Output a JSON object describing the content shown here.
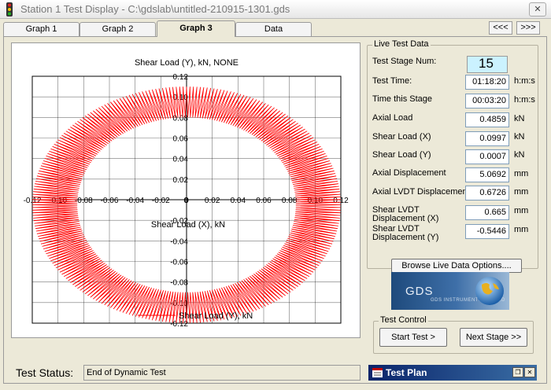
{
  "window": {
    "title": "Station 1 Test Display - C:\\gdslab\\untitled-210915-1301.gds",
    "close_label": "✕"
  },
  "tabs": [
    {
      "label": "Graph 1"
    },
    {
      "label": "Graph 2"
    },
    {
      "label": "Graph 3"
    },
    {
      "label": "Data"
    }
  ],
  "nav": {
    "prev_label": "<<<",
    "next_label": ">>>"
  },
  "chart_data": {
    "type": "line",
    "title": "Shear Load (Y), kN, NONE",
    "xlabel": "Shear Load (X), kN",
    "ylabel": "",
    "xlim": [
      -0.12,
      0.12
    ],
    "ylim": [
      -0.12,
      0.12
    ],
    "x_ticks": [
      "-0.12",
      "-0.10",
      "-0.08",
      "-0.06",
      "-0.04",
      "-0.02",
      "0",
      "0.02",
      "0.04",
      "0.06",
      "0.08",
      "0.10",
      "0.12"
    ],
    "y_ticks": [
      "0.12",
      "0.10",
      "0.08",
      "0.06",
      "0.04",
      "0.02",
      "0",
      "-0.02",
      "-0.04",
      "-0.06",
      "-0.08",
      "-0.10",
      "-0.12"
    ],
    "grid": true,
    "legend": "bottom",
    "series": [
      {
        "name": "Shear Load (Y), kN",
        "color": "#ff0000",
        "shape": "elliptical orbit",
        "x_range": [
          -0.12,
          0.12
        ],
        "y_range": [
          -0.12,
          0.11
        ],
        "inner_x_range": [
          -0.085,
          0.085
        ],
        "inner_y_range": [
          -0.085,
          0.085
        ]
      }
    ]
  },
  "live": {
    "title": "Live Test Data",
    "fields": [
      {
        "label": "Test Stage Num:",
        "value": "15",
        "unit": ""
      },
      {
        "label": "Test Time:",
        "value": "01:18:20",
        "unit": "h:m:s"
      },
      {
        "label": "Time this Stage",
        "value": "00:03:20",
        "unit": "h:m:s"
      },
      {
        "label": "Axial Load",
        "value": "0.4859",
        "unit": "kN"
      },
      {
        "label": "Shear Load (X)",
        "value": "0.0997",
        "unit": "kN"
      },
      {
        "label": "Shear Load (Y)",
        "value": "0.0007",
        "unit": "kN"
      },
      {
        "label": "Axial Displacement",
        "value": "5.0692",
        "unit": "mm"
      },
      {
        "label": "Axial LVDT Displacement",
        "value": "0.6726",
        "unit": "mm"
      },
      {
        "label": "Shear LVDT Displacement (X)",
        "value": "0.665",
        "unit": "mm"
      },
      {
        "label": "Shear LVDT Displacement (Y)",
        "value": "-0.5446",
        "unit": "mm"
      }
    ],
    "browse_label": "Browse Live Data Options...."
  },
  "logo": {
    "text": "GDS",
    "sub": "GDS INSTRUMENTS LIMITED"
  },
  "test_control": {
    "title": "Test Control",
    "start_label": "Start Test >",
    "next_label": "Next Stage >>"
  },
  "status": {
    "label": "Test Status:",
    "value": "End of Dynamic Test"
  },
  "test_plan": {
    "title": "Test Plan",
    "restore_label": "❐",
    "close_label": "✕"
  },
  "colors": {
    "series": "#ff0000",
    "stage_bg": "#cbf2ff",
    "testplan_bar": "#0a246a"
  }
}
